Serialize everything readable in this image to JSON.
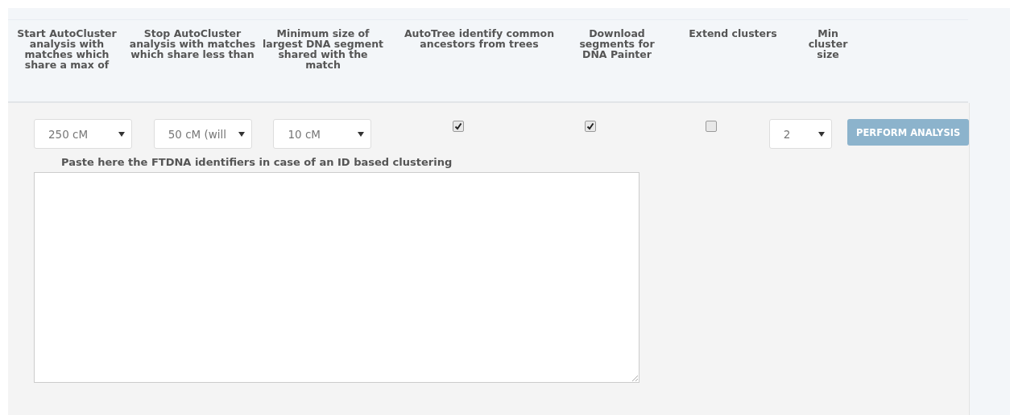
{
  "columns": [
    {
      "heading": "Start AutoCluster analysis with matches which share a max of",
      "kind": "select",
      "value": "250 cM"
    },
    {
      "heading": "Stop AutoCluster analysis with matches which share less than",
      "kind": "select",
      "value": "50 cM (will"
    },
    {
      "heading": "Minimum size of largest DNA segment shared with the match",
      "kind": "select",
      "value": "10 cM"
    },
    {
      "heading": "AutoTree identify common ancestors from trees",
      "kind": "checkbox",
      "checked": true
    },
    {
      "heading": "Download segments for DNA Painter",
      "kind": "checkbox",
      "checked": true
    },
    {
      "heading": "Extend clusters",
      "kind": "checkbox",
      "checked": false
    },
    {
      "heading": "Min cluster size",
      "kind": "small-select",
      "value": "2"
    }
  ],
  "action_button": "PERFORM ANALYSIS",
  "ids_label": "Paste here the FTDNA identifiers in case of an ID based clustering"
}
